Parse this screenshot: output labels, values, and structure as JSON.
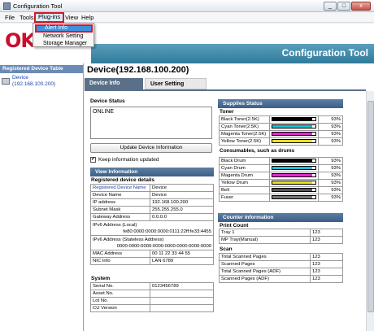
{
  "window": {
    "title": "Configuration Tool",
    "min": "_",
    "max": "□",
    "close": "x"
  },
  "menubar": {
    "items": [
      "File",
      "Tools",
      "Plug-ins",
      "View",
      "Help"
    ]
  },
  "plugins_menu": {
    "items": [
      "Alert Info",
      "Network Setting",
      "Storage Manager"
    ]
  },
  "brand": {
    "logo": "OKI",
    "title": "Configuration Tool",
    "accent": "#c8102e",
    "bar": "#3f86a6"
  },
  "left": {
    "header": "Registered Device Table",
    "device_line1": "Device",
    "device_line2": "(192.168.100.200)"
  },
  "main": {
    "title": "Device(192.168.100.200)",
    "tabs": [
      "Device Info",
      "User Setting"
    ]
  },
  "status": {
    "heading": "Device Status",
    "text": "ONLINE",
    "update_button": "Update Device Information",
    "keep_label": "Keep information updated",
    "keep_checked": true
  },
  "view_info": {
    "heading": "View Information",
    "registered_heading": "Registered device details",
    "rows": [
      [
        "Registered Device Name",
        "Device"
      ],
      [
        "Device Name",
        "Device"
      ],
      [
        "IP address",
        "192.168.100.200"
      ],
      [
        "Subnet Mask",
        "255.255.255.0"
      ],
      [
        "Gateway Address",
        "0.0.0.0"
      ]
    ],
    "ipv6_local_label": "IPv6 Address (Local)",
    "ipv6_local_value": "fe80:0000:0000:0000:0111:22ff:fe33:4455",
    "ipv6_stateless_label": "IPv6 Address (Stateless Address)",
    "ipv6_stateless_value": "0000:0000:0000:0000:0000:0000:0000:0000",
    "rows2": [
      [
        "MAC Address",
        "00 11 22 33 44 55"
      ],
      [
        "NIC Info",
        "LAN 6789"
      ]
    ],
    "system_heading": "System",
    "system_rows": [
      [
        "Serial No.",
        "0123456789"
      ],
      [
        "Asset No.",
        ""
      ],
      [
        "Lot No.",
        ""
      ],
      [
        "CU Version",
        ""
      ]
    ]
  },
  "supplies": {
    "heading": "Supplies Status",
    "toner_heading": "Toner",
    "toner": [
      {
        "name": "Black Toner(2.5K)",
        "level": 93,
        "label": "93%",
        "color": "#000000"
      },
      {
        "name": "Cyan Toner(2.5K)",
        "level": 93,
        "label": "93%",
        "color": "#19c3d6"
      },
      {
        "name": "Magenta Toner(2.5K)",
        "level": 93,
        "label": "93%",
        "color": "#e02ad0"
      },
      {
        "name": "Yellow Toner(2.5K)",
        "level": 93,
        "label": "93%",
        "color": "#e8e21a"
      }
    ],
    "consumables_heading": "Consumables, such as drums",
    "drums": [
      {
        "name": "Black Drum",
        "level": 93,
        "label": "93%",
        "color": "#000000"
      },
      {
        "name": "Cyan Drum",
        "level": 93,
        "label": "93%",
        "color": "#19c3d6"
      },
      {
        "name": "Magenta Drum",
        "level": 93,
        "label": "93%",
        "color": "#e02ad0"
      },
      {
        "name": "Yellow Drum",
        "level": 93,
        "label": "93%",
        "color": "#e8e21a"
      },
      {
        "name": "Belt",
        "level": 93,
        "label": "93%",
        "color": "#555555"
      },
      {
        "name": "Fuser",
        "level": 93,
        "label": "93%",
        "color": "#777777"
      }
    ]
  },
  "counter": {
    "heading": "Counter information",
    "print_heading": "Print Count",
    "print_rows": [
      [
        "Tray 1",
        "123"
      ],
      [
        "MP Tray(Manual)",
        "123"
      ]
    ],
    "scan_heading": "Scan",
    "scan_rows": [
      [
        "Total Scanned Pages",
        "123"
      ],
      [
        "Scanned Pages",
        "123"
      ],
      [
        "Total Scanned Pages (ADF)",
        "123"
      ],
      [
        "Scanned Pages (ADF)",
        "123"
      ]
    ]
  }
}
